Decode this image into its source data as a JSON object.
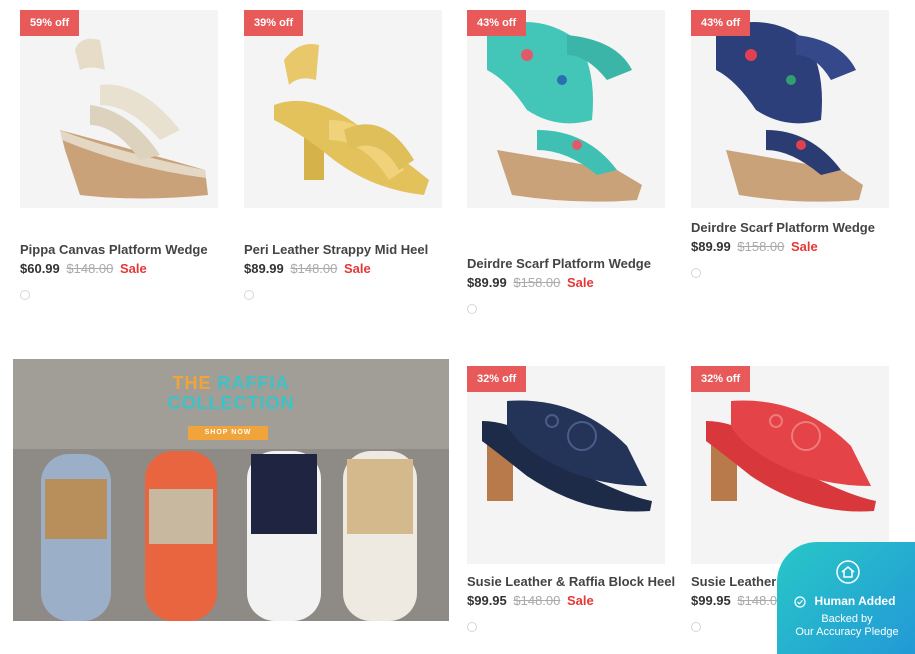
{
  "products": [
    {
      "name": "Pippa Canvas Platform Wedge",
      "price": "$60.99",
      "was": "$148.00",
      "sale": "Sale",
      "badge": "59% off"
    },
    {
      "name": "Peri Leather Strappy Mid Heel",
      "price": "$89.99",
      "was": "$148.00",
      "sale": "Sale",
      "badge": "39% off"
    },
    {
      "name": "Deirdre Scarf Platform Wedge",
      "price": "$89.99",
      "was": "$158.00",
      "sale": "Sale",
      "badge": "43% off"
    },
    {
      "name": "Deirdre Scarf Platform Wedge",
      "price": "$89.99",
      "was": "$158.00",
      "sale": "Sale",
      "badge": "43% off"
    },
    {
      "name": "Susie Leather & Raffia Block Heel",
      "price": "$99.95",
      "was": "$148.00",
      "sale": "Sale",
      "badge": "32% off"
    },
    {
      "name": "Susie Leather & Raffia Block Heel",
      "price": "$99.95",
      "was": "$148.00",
      "sale": "",
      "badge": "32% off"
    }
  ],
  "banner": {
    "title_accent": "THE",
    "title_rest": "RAFFIA",
    "title_line2": "COLLECTION",
    "cta": "SHOP NOW"
  },
  "trust_badge": {
    "title": "Human Added",
    "line1": "Backed by",
    "line2": "Our Accuracy Pledge"
  },
  "colors": {
    "badge_bg": "#e85a5a",
    "sale_text": "#e53935",
    "banner_title_accent": "#f0a43a",
    "banner_title_teal": "#3cc3c8",
    "trust_gradient_start": "#28c7c7",
    "trust_gradient_end": "#2296d8"
  }
}
